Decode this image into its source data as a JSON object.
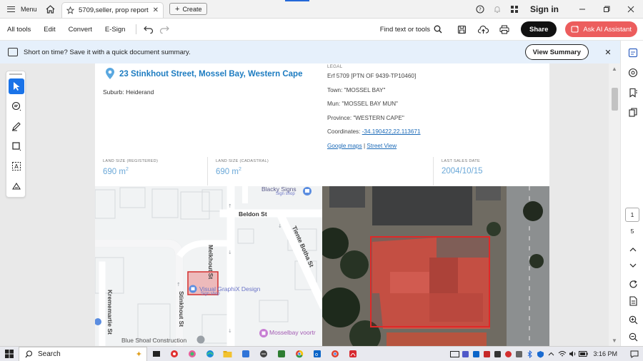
{
  "titlebar": {
    "menu_label": "Menu",
    "tab_label": "5709,seller, prop report...",
    "tab_close": "✕",
    "create_label": "Create",
    "signin_label": "Sign in"
  },
  "toolbar": {
    "menus": [
      "All tools",
      "Edit",
      "Convert",
      "E-Sign"
    ],
    "find_label": "Find text or tools",
    "share_label": "Share",
    "ai_label": "Ask AI Assistant"
  },
  "banner": {
    "text": "Short on time? Save it with a quick document summary.",
    "button_label": "View Summary",
    "close_label": "✕"
  },
  "document": {
    "address": "23 Stinkhout Street, Mossel Bay, Western Cape",
    "suburb": "Suburb: Heiderand",
    "legal_heading": "LEGAL",
    "legal_erf": "Erf 5709 [PTN OF 9439-TP10460]",
    "legal_town": "Town: \"MOSSEL BAY\"",
    "legal_mun": "Mun: \"MOSSEL BAY MUN\"",
    "legal_province": "Province: \"WESTERN CAPE\"",
    "coordinates_label": "Coordinates: ",
    "coordinates_value": "-34.190422,22.113671",
    "google_maps": "Google maps",
    "link_sep": " | ",
    "street_view": "Street View",
    "stats": [
      {
        "heading": "LAND SIZE (REGISTERED)",
        "value": "690 m",
        "unit_sup": "2"
      },
      {
        "heading": "LAND SIZE (CADASTRAL)",
        "value": "690 m",
        "unit_sup": "2"
      },
      {
        "heading": "LAST SALES DATE",
        "value": "2004/10/15",
        "unit_sup": ""
      }
    ]
  },
  "map": {
    "labels": {
      "blacky": "Blacky Signs",
      "blacky_sub": "Sign shop",
      "beldon": "Beldon St",
      "melkhout": "Melkhout St",
      "tiente": "Tiente Botha St",
      "krememartie": "Krememartie St",
      "stinkhout": "Stinkhout St",
      "visual": "Visual GraphiX Design",
      "visual_sub": "Sign shop",
      "blueshoal": "Blue Shoal Construction",
      "mosselbay": "Mosselbay voortr"
    }
  },
  "right_rail": {
    "page_current": "1",
    "page_total": "5"
  },
  "taskbar": {
    "search_label": "Search",
    "time": "3:16 PM"
  },
  "colors": {
    "accent": "#1a73e8",
    "ai_button": "#ec5d5d",
    "banner_bg": "#e6f0fb",
    "link": "#1d7cc1"
  }
}
